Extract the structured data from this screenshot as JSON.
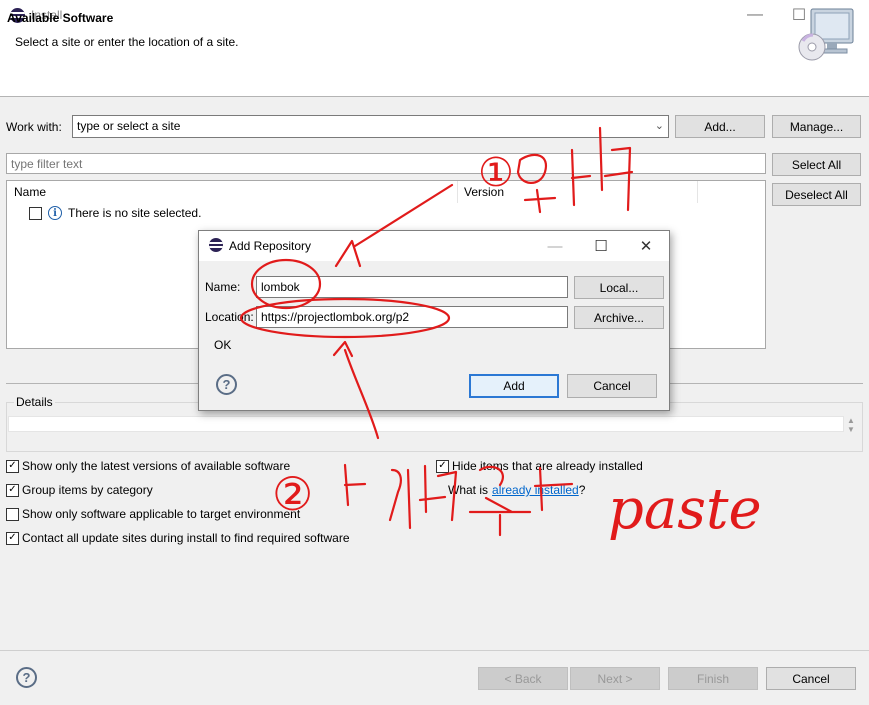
{
  "window": {
    "title": "Install",
    "header_title": "Available Software",
    "header_desc": "Select a site or enter the location of a site."
  },
  "workwith": {
    "label": "Work with:",
    "combo_value": "type or select a site",
    "add_label": "Add...",
    "manage_label": "Manage..."
  },
  "filter": {
    "placeholder": "type filter text",
    "select_all": "Select All",
    "deselect_all": "Deselect All"
  },
  "tree": {
    "col_name": "Name",
    "col_version": "Version",
    "empty_message": "There is no site selected."
  },
  "details": {
    "label": "Details"
  },
  "options": {
    "latest_versions": "Show only the latest versions of available software",
    "group_by_category": "Group items by category",
    "applicable_only": "Show only software applicable to target environment",
    "contact_sites": "Contact all update sites during install to find required software",
    "hide_installed": "Hide items that are already installed",
    "what_is": "What is",
    "already_installed_link": "already installed",
    "question": "?"
  },
  "footer": {
    "back": "< Back",
    "next": "Next >",
    "finish": "Finish",
    "cancel": "Cancel"
  },
  "dialog": {
    "title": "Add Repository",
    "name_label": "Name:",
    "name_value": "lombok",
    "location_label": "Location:",
    "location_value": "https://projectlombok.org/p2",
    "status": "OK",
    "local_button": "Local...",
    "archive_button": "Archive...",
    "add_button": "Add",
    "cancel_button": "Cancel"
  },
  "annotation": {
    "marker_1": "①",
    "marker_2": "②",
    "note_2_tail": "paste"
  },
  "colors": {
    "annotation_red": "#e11b1b",
    "link_blue": "#0066cc",
    "focus_blue": "#2b78d4"
  }
}
